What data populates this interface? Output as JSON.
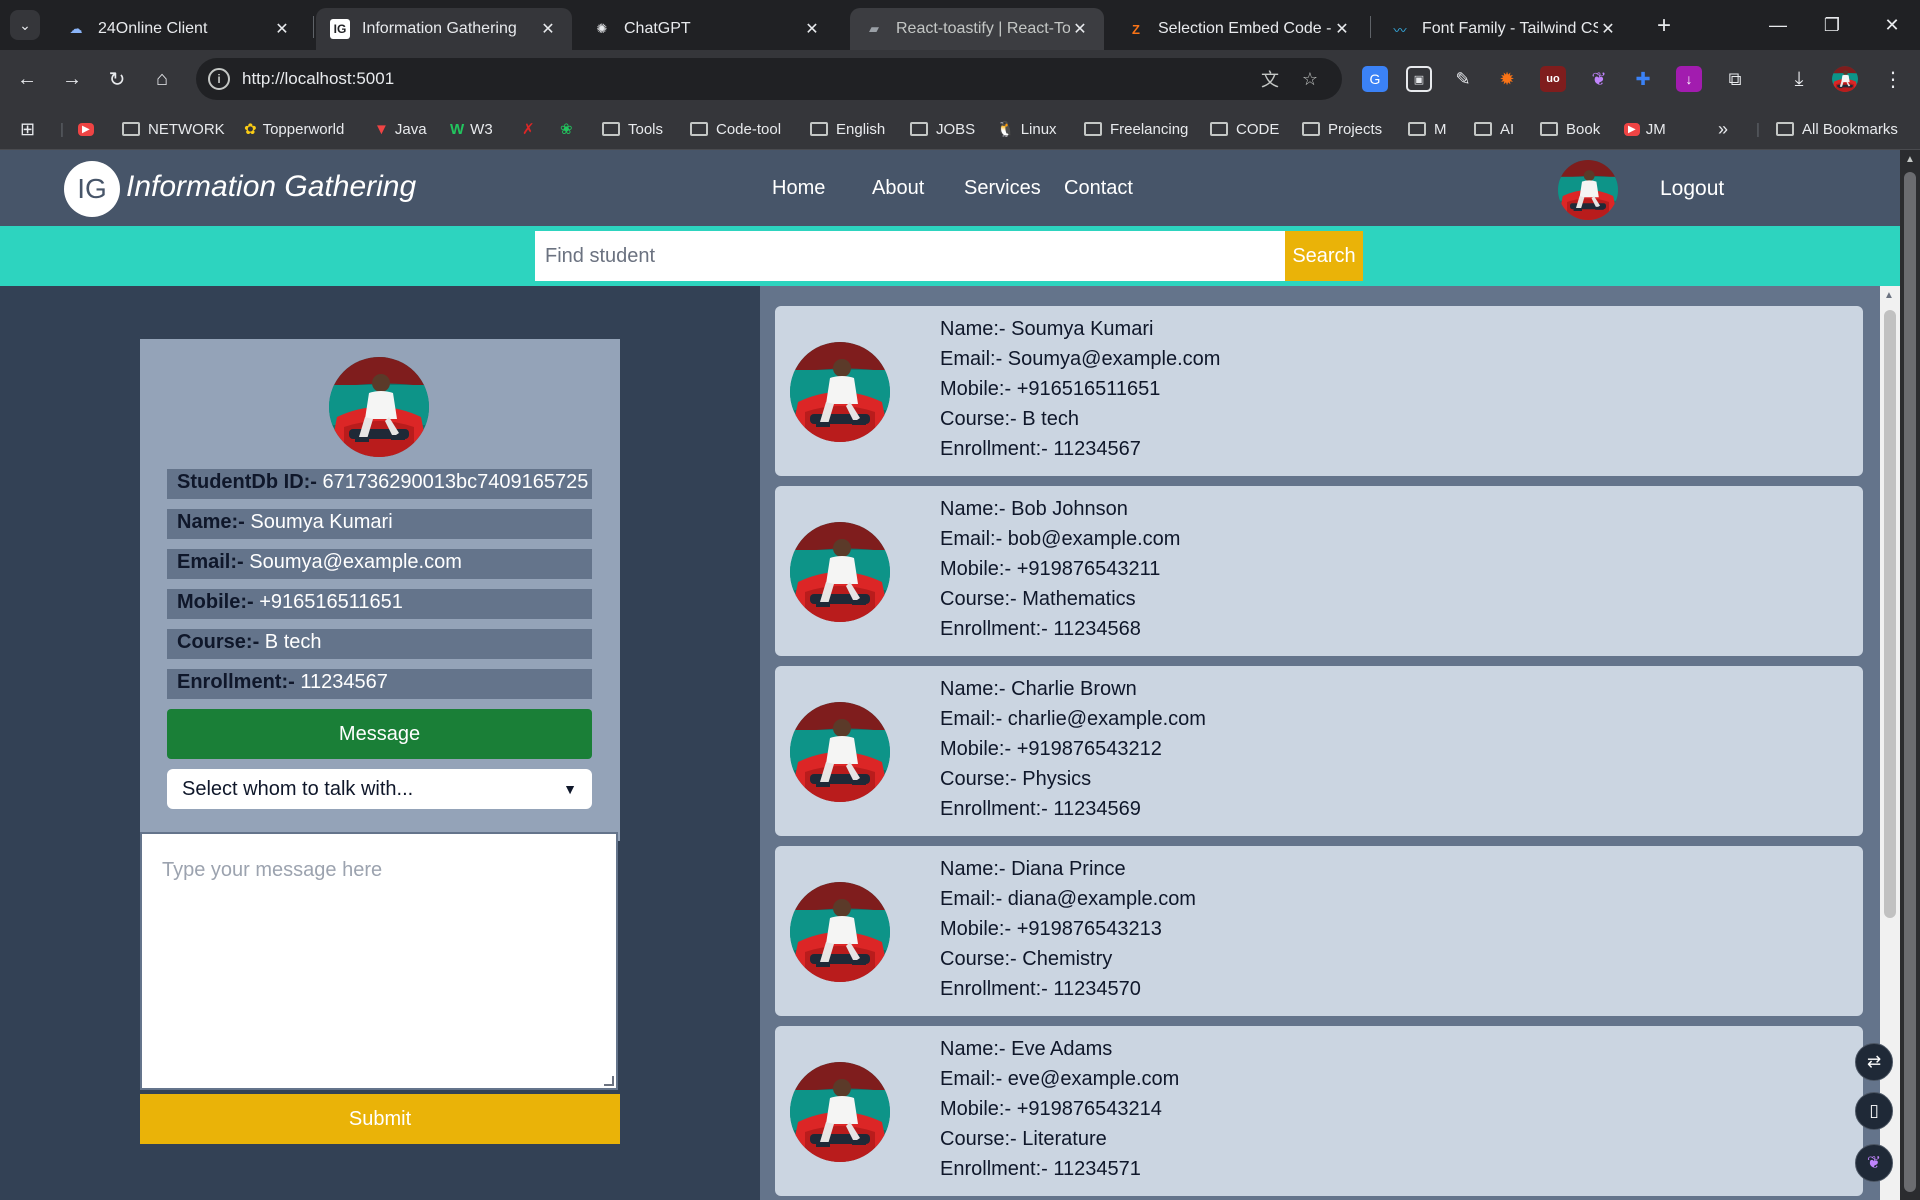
{
  "browser": {
    "tabs": [
      {
        "title": "24Online Client",
        "icon": "cloud-icon"
      },
      {
        "title": "Information Gathering",
        "icon": "ig-favicon"
      },
      {
        "title": "ChatGPT",
        "icon": "chatgpt-icon"
      },
      {
        "title": "React-toastify | React-Toast",
        "icon": "react-toastify-icon"
      },
      {
        "title": "Selection Embed Code - G",
        "icon": "zoho-icon"
      },
      {
        "title": "Font Family - Tailwind CSS",
        "icon": "tailwind-icon"
      }
    ],
    "active_tab": "Information Gathering",
    "url": "http://localhost:5001",
    "bookmarks": [
      "NETWORK",
      "Topperworld",
      "Java",
      "W3",
      "Tools",
      "Code-tool",
      "English",
      "JOBS",
      "Linux",
      "Freelancing",
      "CODE",
      "Projects",
      "M",
      "AI",
      "Book",
      "JM"
    ],
    "all_bookmarks": "All Bookmarks"
  },
  "app": {
    "logo_initials": "IG",
    "title": "Information Gathering",
    "nav": [
      "Home",
      "About",
      "Services",
      "Contact"
    ],
    "logout": "Logout",
    "search": {
      "placeholder": "Find student",
      "button": "Search"
    }
  },
  "labels": {
    "id": "StudentDb ID:-",
    "name": "Name:-",
    "email": "Email:-",
    "mobile": "Mobile:-",
    "course": "Course:-",
    "enrollment": "Enrollment:-"
  },
  "selected_student": {
    "id": "671736290013bc7409165725",
    "name": "Soumya Kumari",
    "email": "Soumya@example.com",
    "mobile": "+916516511651",
    "course": "B tech",
    "enrollment": "11234567"
  },
  "message": {
    "button": "Message",
    "select_placeholder": "Select whom to talk with...",
    "textarea_placeholder": "Type your message here",
    "submit": "Submit"
  },
  "students": [
    {
      "name": "Soumya Kumari",
      "email": "Soumya@example.com",
      "mobile": "+916516511651",
      "course": "B tech",
      "enrollment": "11234567"
    },
    {
      "name": "Bob Johnson",
      "email": "bob@example.com",
      "mobile": "+919876543211",
      "course": "Mathematics",
      "enrollment": "11234568"
    },
    {
      "name": "Charlie Brown",
      "email": "charlie@example.com",
      "mobile": "+919876543212",
      "course": "Physics",
      "enrollment": "11234569"
    },
    {
      "name": "Diana Prince",
      "email": "diana@example.com",
      "mobile": "+919876543213",
      "course": "Chemistry",
      "enrollment": "11234570"
    },
    {
      "name": "Eve Adams",
      "email": "eve@example.com",
      "mobile": "+919876543214",
      "course": "Literature",
      "enrollment": "11234571"
    }
  ],
  "colors": {
    "navbar": "#475569",
    "page_bg": "#334155",
    "search_strip": "#2dd4bf",
    "accent_yellow": "#eab308",
    "message_green": "#1a7f37",
    "card_bg": "#cbd5e1"
  }
}
